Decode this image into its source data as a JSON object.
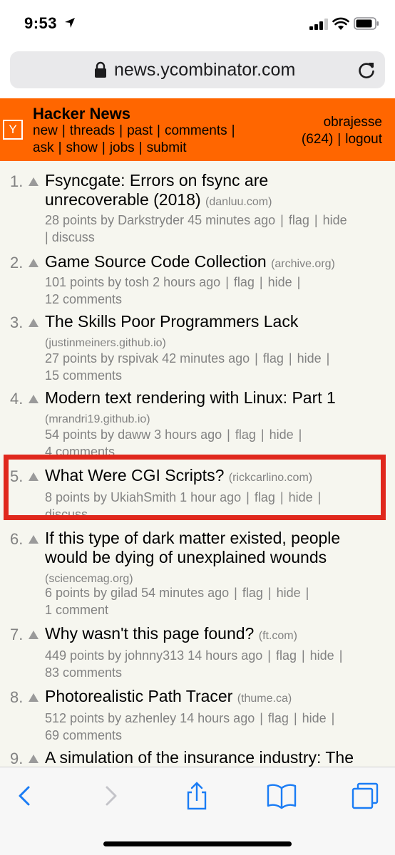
{
  "status_bar": {
    "time": "9:53"
  },
  "browser": {
    "url": "news.ycombinator.com"
  },
  "hn": {
    "logo": "Y",
    "title": "Hacker News",
    "nav": [
      "new",
      "threads",
      "past",
      "comments",
      "ask",
      "show",
      "jobs",
      "submit"
    ],
    "username": "obrajesse",
    "karma": "(624)",
    "logout": "logout"
  },
  "stories": [
    {
      "rank": "1.",
      "title_line1": "Fsyncgate: Errors on fsync are",
      "title_line2": "unrecoverable (2018)",
      "domain": "(danluu.com)",
      "meta": "28 points by Darkstryder 45 minutes ago",
      "flag": "flag",
      "hide": "hide",
      "comments": "discuss"
    },
    {
      "rank": "2.",
      "title_line1": "Game Source Code Collection",
      "domain": "(archive.org)",
      "meta": "101 points by tosh 2 hours ago",
      "flag": "flag",
      "hide": "hide",
      "comments": "12 comments"
    },
    {
      "rank": "3.",
      "title_line1": "The Skills Poor Programmers Lack",
      "domain": "(justinmeiners.github.io)",
      "meta": "27 points by rspivak 42 minutes ago",
      "flag": "flag",
      "hide": "hide",
      "comments": "15 comments"
    },
    {
      "rank": "4.",
      "title_line1": "Modern text rendering with Linux: Part 1",
      "domain": "(mrandri19.github.io)",
      "meta": "54 points by daww 3 hours ago",
      "flag": "flag",
      "hide": "hide",
      "comments": "4 comments"
    },
    {
      "rank": "5.",
      "title_line1": "What Were CGI Scripts?",
      "domain": "(rickcarlino.com)",
      "meta": "8 points by UkiahSmith 1 hour ago",
      "flag": "flag",
      "hide": "hide",
      "comments": "discuss"
    },
    {
      "rank": "6.",
      "title_line1": "If this type of dark matter existed, people",
      "title_line2": "would be dying of unexplained wounds",
      "domain": "(sciencemag.org)",
      "meta": "6 points by gilad 54 minutes ago",
      "flag": "flag",
      "hide": "hide",
      "comments": "1 comment"
    },
    {
      "rank": "7.",
      "title_line1": "Why wasn't this page found?",
      "domain": "(ft.com)",
      "meta": "449 points by johnny313 14 hours ago",
      "flag": "flag",
      "hide": "hide",
      "comments": "83 comments"
    },
    {
      "rank": "8.",
      "title_line1": "Photorealistic Path Tracer",
      "domain": "(thume.ca)",
      "meta": "512 points by azhenley 14 hours ago",
      "flag": "flag",
      "hide": "hide",
      "comments": "69 comments"
    },
    {
      "rank": "9.",
      "title_line1": "A simulation of the insurance industry: The"
    }
  ],
  "colors": {
    "hn_orange": "#ff6600",
    "highlight_red": "#e0281d",
    "meta_gray": "#828282",
    "ios_blue": "#1a7cf5"
  },
  "toolbar_icons": [
    "back-icon",
    "forward-icon",
    "share-icon",
    "bookmarks-icon",
    "tabs-icon"
  ]
}
